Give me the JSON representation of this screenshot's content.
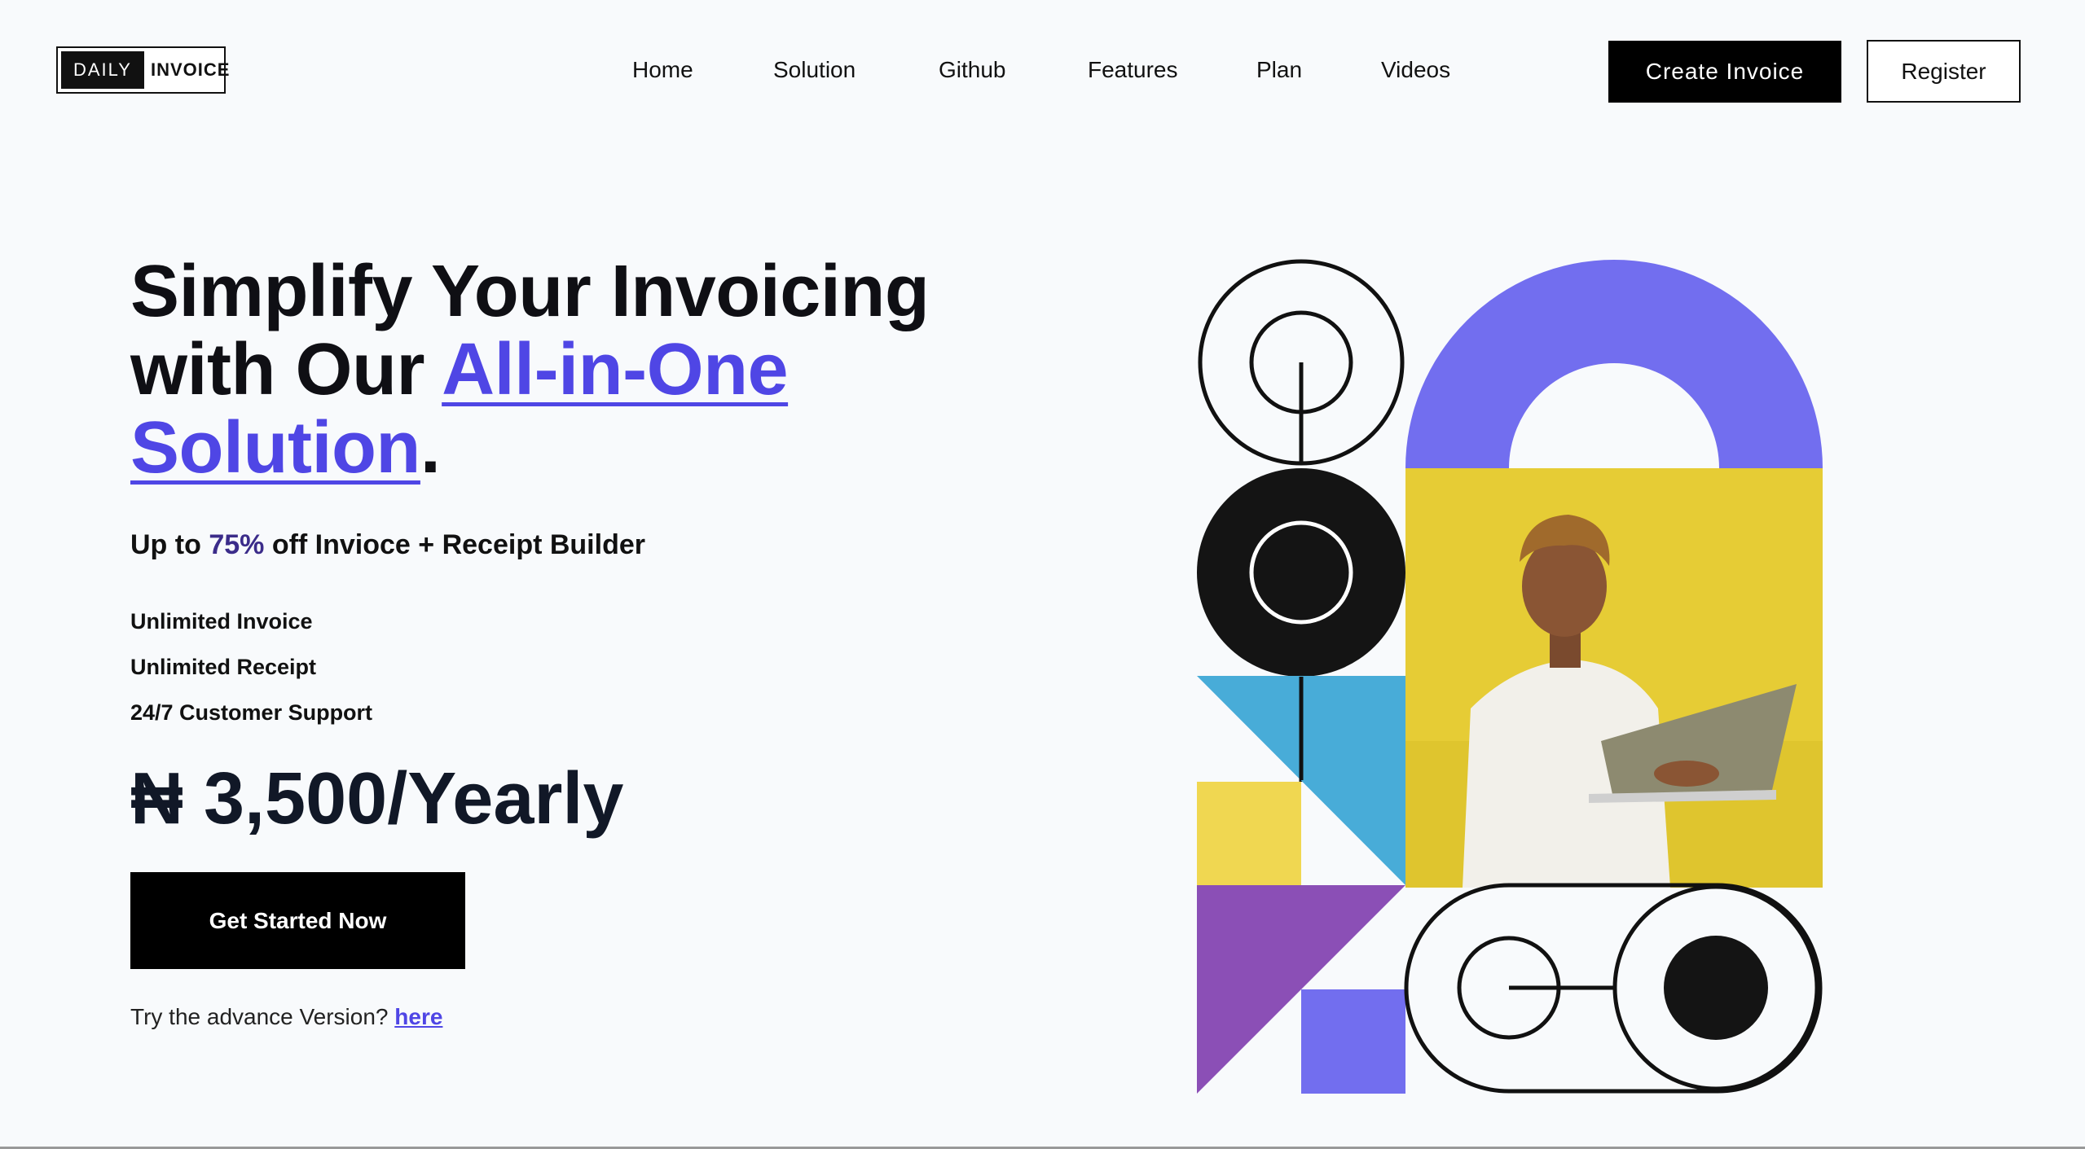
{
  "header": {
    "logo": {
      "part1": "DAILY",
      "part2": "INVOICE"
    },
    "nav": [
      "Home",
      "Solution",
      "Github",
      "Features",
      "Plan",
      "Videos"
    ],
    "create_label": "Create Invoice",
    "register_label": "Register"
  },
  "hero": {
    "title_plain": "Simplify Your Invoicing with Our ",
    "title_accent": "All-in-One Solution",
    "title_end": ".",
    "subline_prefix": "Up to ",
    "subline_percent": "75%",
    "subline_suffix": " off Invioce + Receipt Builder",
    "features": [
      "Unlimited Invoice",
      "Unlimited Receipt",
      "24/7 Customer Support"
    ],
    "price": "₦ 3,500/Yearly",
    "cta_label": "Get Started Now",
    "advance_prefix": "Try the advance Version? ",
    "advance_link": "here"
  },
  "colors": {
    "accent": "#4f46e5",
    "purple_block": "#726eef",
    "violet": "#8b4fb6",
    "sky": "#48acd8",
    "yellow": "#f0d751",
    "photo_bg": "#e6cc35"
  }
}
